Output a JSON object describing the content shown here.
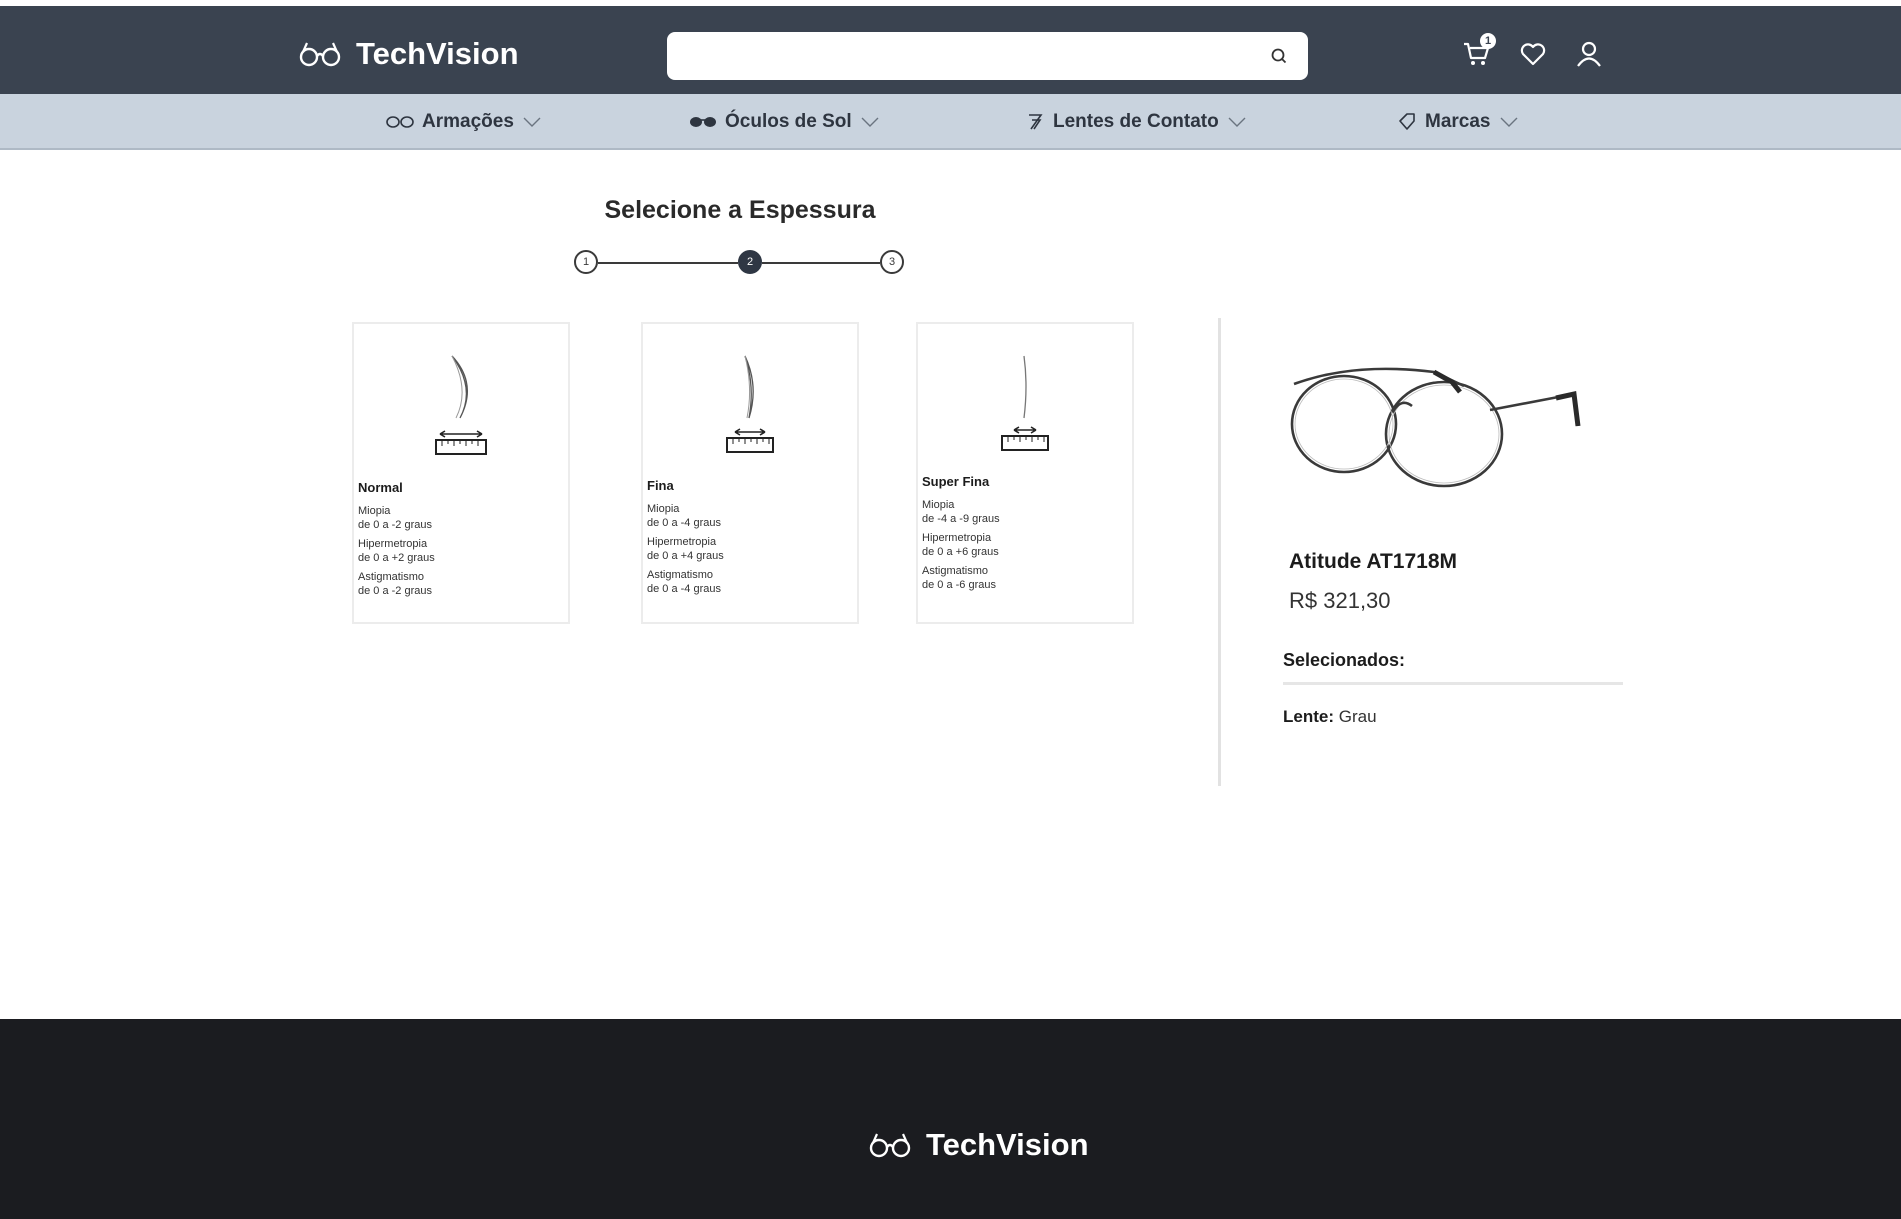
{
  "brand": {
    "name": "TechVision"
  },
  "search": {
    "placeholder": ""
  },
  "header_icons": {
    "cart_badge": "1",
    "icons": [
      "cart-icon",
      "heart-icon",
      "user-icon"
    ]
  },
  "nav": {
    "items": [
      {
        "label": "Armações",
        "icon": "glasses-outline-icon"
      },
      {
        "label": "Óculos de Sol",
        "icon": "sunglasses-icon"
      },
      {
        "label": "Lentes de Contato",
        "icon": "contact-lens-icon"
      },
      {
        "label": "Marcas",
        "icon": "tag-icon"
      }
    ]
  },
  "steps": {
    "title": "Selecione a Espessura",
    "labels": [
      "1",
      "2",
      "3"
    ],
    "active": 2
  },
  "options": [
    {
      "title": "Normal",
      "lines": [
        {
          "name": "Miopia",
          "range": "de 0 a -2 graus"
        },
        {
          "name": "Hipermetropia",
          "range": "de 0 a +2 graus"
        },
        {
          "name": "Astigmatismo",
          "range": "de 0 a -2 graus"
        }
      ]
    },
    {
      "title": "Fina",
      "lines": [
        {
          "name": "Miopia",
          "range": "de 0 a -4 graus"
        },
        {
          "name": "Hipermetropia",
          "range": "de 0 a +4 graus"
        },
        {
          "name": "Astigmatismo",
          "range": "de 0 a -4 graus"
        }
      ]
    },
    {
      "title": "Super Fina",
      "lines": [
        {
          "name": "Miopia",
          "range": "de -4 a -9 graus"
        },
        {
          "name": "Hipermetropia",
          "range": "de 0 a +6 graus"
        },
        {
          "name": "Astigmatismo",
          "range": "de 0 a -6 graus"
        }
      ]
    }
  ],
  "product": {
    "name": "Atitude AT1718M",
    "price": "R$ 321,30",
    "selected_label": "Selecionados:",
    "lens_label": "Lente:",
    "lens_value": "Grau"
  },
  "colors": {
    "header": "#3a4350",
    "nav": "#c9d3de",
    "footer": "#1b1c20",
    "active_step": "#2f3744"
  }
}
